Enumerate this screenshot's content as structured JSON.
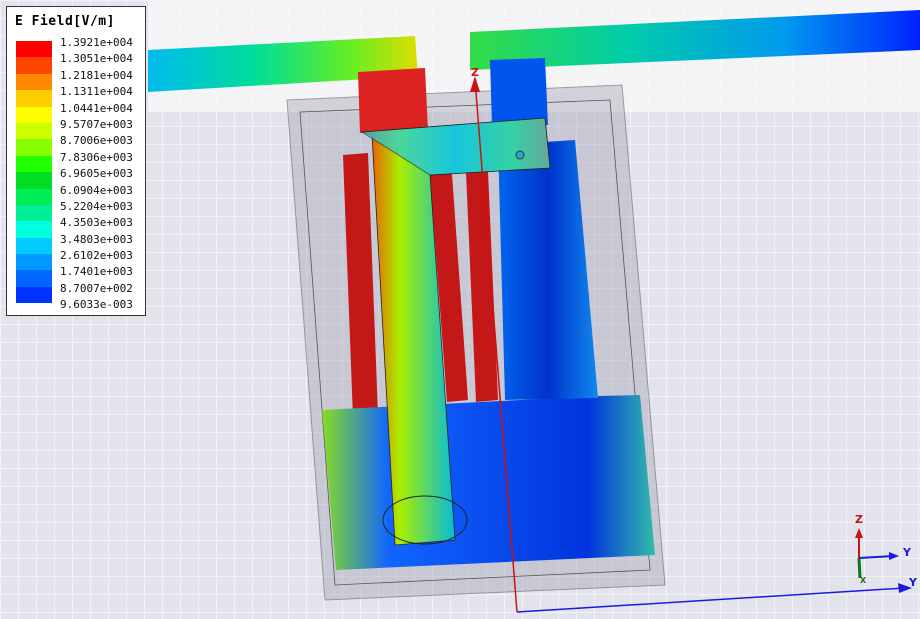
{
  "legend": {
    "title": "E Field[V/m]",
    "values": [
      "1.3921e+004",
      "1.3051e+004",
      "1.2181e+004",
      "1.1311e+004",
      "1.0441e+004",
      "9.5707e+003",
      "8.7006e+003",
      "7.8306e+003",
      "6.9605e+003",
      "6.0904e+003",
      "5.2204e+003",
      "4.3503e+003",
      "3.4803e+003",
      "2.6102e+003",
      "1.7401e+003",
      "8.7007e+002",
      "9.6033e-003"
    ],
    "colors": [
      "#ff0000",
      "#ff4400",
      "#ff8800",
      "#ffcc00",
      "#ffff00",
      "#ccff00",
      "#88ff00",
      "#22ff00",
      "#00dd22",
      "#00ee55",
      "#00ee99",
      "#00ffdd",
      "#00ccff",
      "#0099ff",
      "#0066ff",
      "#0033ff",
      "#0000ff"
    ]
  },
  "axes": {
    "z": "Z",
    "y": "Y",
    "x": "X",
    "main_z": "Z",
    "main_y": "Y"
  },
  "colors": {
    "z_axis": "#cc1111",
    "y_axis": "#1a1add",
    "x_axis": "#117711"
  }
}
